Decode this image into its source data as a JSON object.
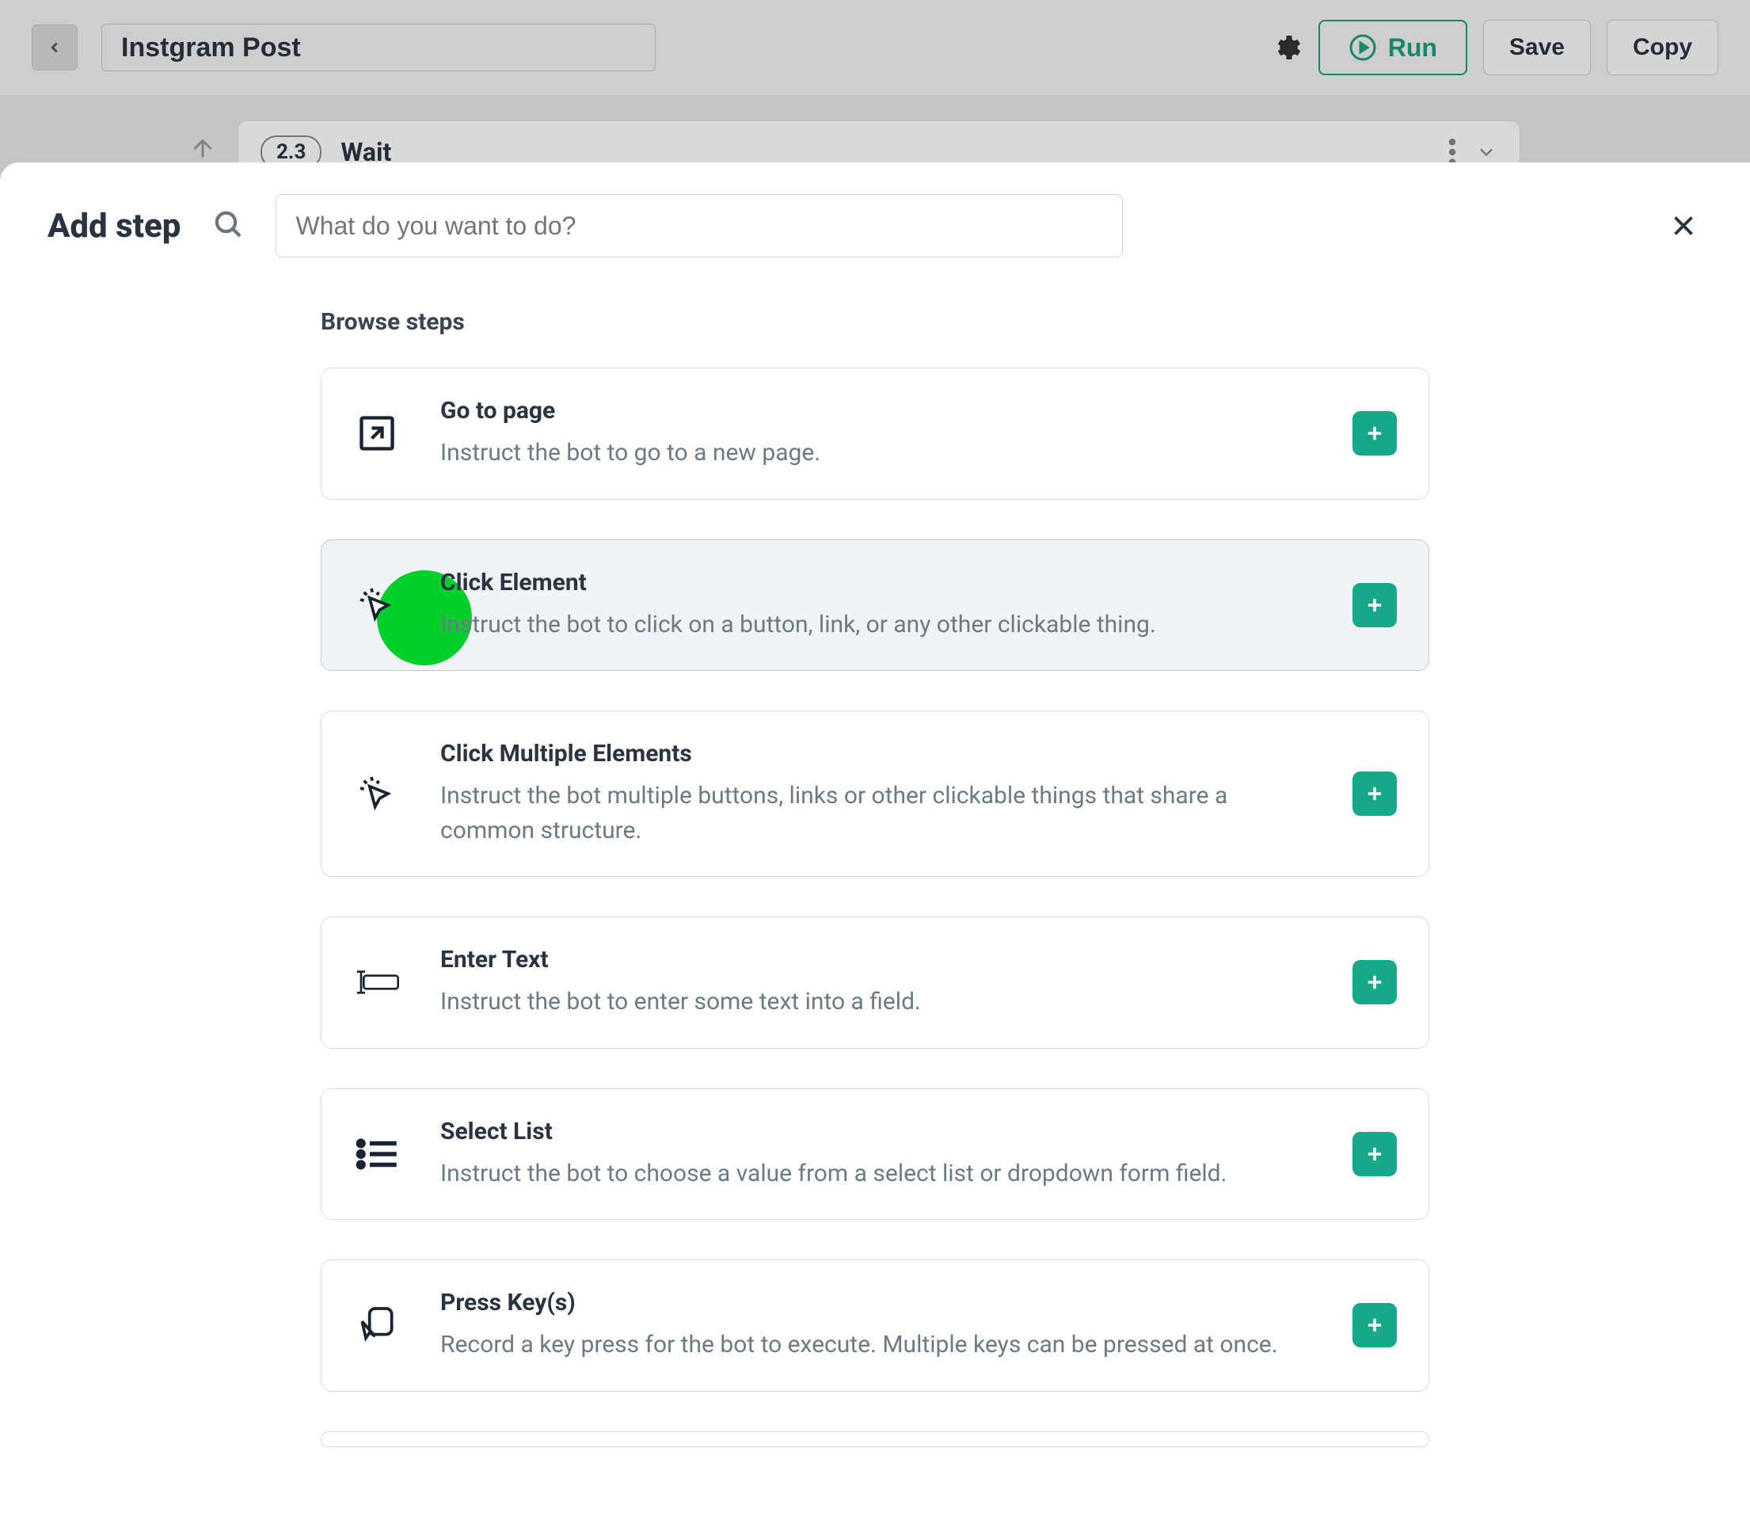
{
  "topbar": {
    "title": "Instgram Post",
    "run_label": "Run",
    "save_label": "Save",
    "copy_label": "Copy"
  },
  "visible_step": {
    "number": "2.3",
    "label": "Wait"
  },
  "modal": {
    "title": "Add step",
    "search_placeholder": "What do you want to do?",
    "section_label": "Browse steps",
    "steps": [
      {
        "title": "Go to page",
        "desc": "Instruct the bot to go to a new page.",
        "icon": "arrow-out"
      },
      {
        "title": "Click Element",
        "desc": "Instruct the bot to click on a button, link, or any other clickable thing.",
        "icon": "click"
      },
      {
        "title": "Click Multiple Elements",
        "desc": "Instruct the bot multiple buttons, links or other clickable things that share a common structure.",
        "icon": "click"
      },
      {
        "title": "Enter Text",
        "desc": "Instruct the bot to enter some text into a field.",
        "icon": "text-field"
      },
      {
        "title": "Select List",
        "desc": "Instruct the bot to choose a value from a select list or dropdown form field.",
        "icon": "list"
      },
      {
        "title": "Press Key(s)",
        "desc": "Record a key press for the bot to execute. Multiple keys can be pressed at once.",
        "icon": "keypress"
      }
    ]
  }
}
